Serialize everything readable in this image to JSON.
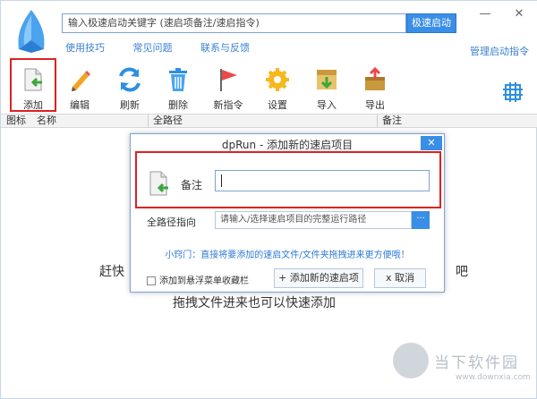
{
  "search": {
    "placeholder": "输入极速启动关键字 (速启项备注/速启指令)",
    "button_label": "极速启动"
  },
  "window_controls": {
    "minimize": "—",
    "close": "✕"
  },
  "links": [
    "使用技巧",
    "常见问题",
    "联系与反馈"
  ],
  "manage_label": "管理启动指令",
  "toolbar": {
    "items": [
      {
        "label": "添加",
        "icon": "add-file-icon"
      },
      {
        "label": "编辑",
        "icon": "pencil-icon"
      },
      {
        "label": "刷新",
        "icon": "refresh-icon"
      },
      {
        "label": "删除",
        "icon": "trash-icon"
      },
      {
        "label": "新指令",
        "icon": "flag-icon"
      },
      {
        "label": "设置",
        "icon": "gear-icon"
      },
      {
        "label": "导入",
        "icon": "import-box-icon"
      },
      {
        "label": "导出",
        "icon": "export-box-icon"
      }
    ]
  },
  "columns": [
    "图标",
    "名称",
    "全路径",
    "备注"
  ],
  "background_hint": {
    "line1_left": "赶快",
    "line1_right": "吧",
    "line2": "拖拽文件进来也可以快速添加"
  },
  "dialog": {
    "title": "dpRun - 添加新的速启项目",
    "close": "✕",
    "note_label": "备注",
    "note_value": "",
    "path_label": "全路径指向",
    "path_placeholder": "请输入/选择速启项目的完整运行路径",
    "path_button": "···",
    "tip": "小窍门：直接将要添加的速启文件/文件夹拖拽进来更方便哦！",
    "fav_label": "添加到悬浮菜单收藏栏",
    "add_button": "+ 添加新的速启项",
    "cancel_button": "x 取消"
  },
  "watermark": {
    "text": "当下软件园",
    "url": "www.downxia.com"
  }
}
